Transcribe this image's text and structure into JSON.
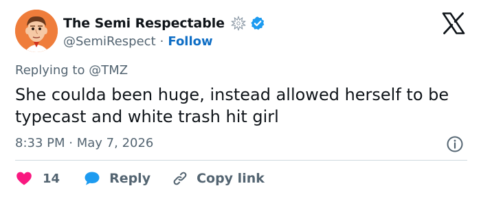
{
  "author": {
    "display_name": "The Semi Respectable",
    "handle": "@SemiRespect",
    "separator": "·",
    "follow_label": "Follow",
    "badge_icon": "burst-badge-icon",
    "verified_icon": "verified-check-icon",
    "verified_color": "#1d9bf0",
    "avatar_color": "#ef7d3b"
  },
  "platform": {
    "logo_icon": "x-logo-icon"
  },
  "tweet": {
    "reply_prefix": "Replying to",
    "reply_to": "@TMZ",
    "text": "She coulda been huge, instead allowed herself to be typecast and white trash hit girl",
    "time": "8:33 PM",
    "date_separator": "·",
    "date": "May 7, 2026",
    "info_icon": "info-icon"
  },
  "actions": {
    "like_icon": "heart-icon",
    "like_color": "#f91880",
    "like_count": "14",
    "reply_icon": "speech-bubble-icon",
    "reply_label": "Reply",
    "copy_icon": "link-icon",
    "copy_label": "Copy link"
  },
  "colors": {
    "text": "#0f1419",
    "muted": "#536471",
    "link": "#0f6ec5",
    "divider": "#cfd9de"
  }
}
